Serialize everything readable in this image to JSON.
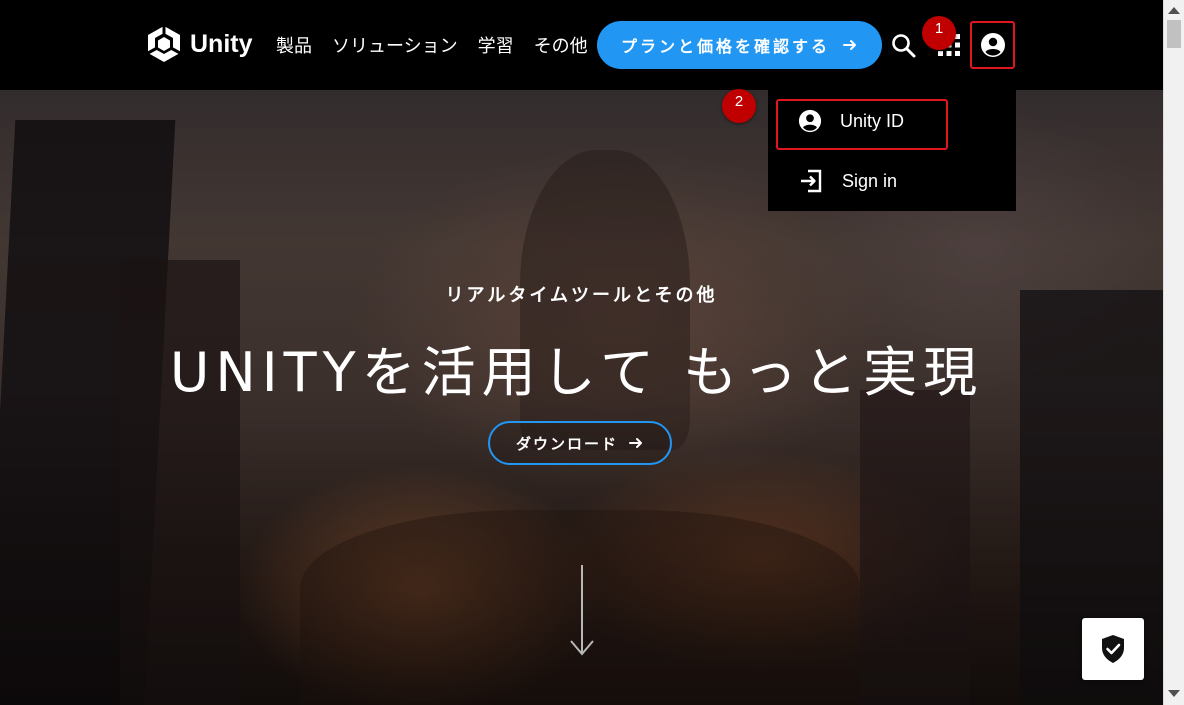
{
  "header": {
    "logo_text": "Unity",
    "nav": [
      "製品",
      "ソリューション",
      "学習",
      "その他"
    ],
    "cta_label": "プランと価格を確認する",
    "icons": [
      "search-icon",
      "apps-grid-icon",
      "account-icon"
    ]
  },
  "dropdown": {
    "items": [
      {
        "label": "Unity ID",
        "icon": "account-circle-icon"
      },
      {
        "label": "Sign in",
        "icon": "sign-in-icon"
      }
    ]
  },
  "hero": {
    "eyebrow": "リアルタイムツールとその他",
    "headline": "UNITYを活用して もっと実現",
    "download_label": "ダウンロード"
  },
  "badges": [
    "1",
    "2"
  ],
  "colors": {
    "accent": "#2196f3",
    "highlight": "#e0161c",
    "badge": "#c00000"
  }
}
